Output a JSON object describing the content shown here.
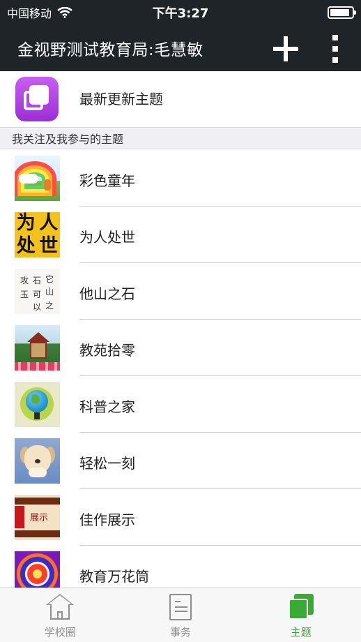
{
  "status_bar": {
    "carrier": "中国移动",
    "time": "下午3:27",
    "battery_level": 0.9,
    "icons": {
      "wifi": "wifi-icon",
      "battery": "battery-icon"
    }
  },
  "nav_bar": {
    "title": "金视野测试教育局:毛慧敏",
    "icons": {
      "add": "plus-icon",
      "more": "more-vertical-icon"
    }
  },
  "latest": {
    "label": "最新更新主题",
    "icon": "stacked-squares-icon",
    "accent": "#b247e6"
  },
  "section_header": "我关注及我参与的主题",
  "topics": [
    {
      "label": "彩色童年",
      "thumb": "rainbow-thumbnail"
    },
    {
      "label": "为人处世",
      "thumb": "为人处世",
      "thumb_text": [
        "为",
        "人",
        "处",
        "世"
      ]
    },
    {
      "label": "他山之石",
      "thumb": "calligraphy-thumbnail",
      "thumb_text": [
        "攻",
        "石",
        "它",
        "玉",
        "可",
        "山",
        "以",
        "之"
      ]
    },
    {
      "label": "教苑拾零",
      "thumb": "pavilion-thumbnail"
    },
    {
      "label": "科普之家",
      "thumb": "globe-thumbnail"
    },
    {
      "label": "轻松一刻",
      "thumb": "puppy-thumbnail"
    },
    {
      "label": "佳作展示",
      "thumb": "scroll-thumbnail",
      "thumb_text": "展示"
    },
    {
      "label": "教育万花筒",
      "thumb": "kaleidoscope-thumbnail"
    }
  ],
  "tab_bar": {
    "active_color": "#3aa935",
    "tabs": [
      {
        "label": "学校圈",
        "icon": "house-icon",
        "active": false
      },
      {
        "label": "事务",
        "icon": "document-icon",
        "active": false
      },
      {
        "label": "主题",
        "icon": "stacked-squares-icon",
        "active": true
      }
    ]
  }
}
